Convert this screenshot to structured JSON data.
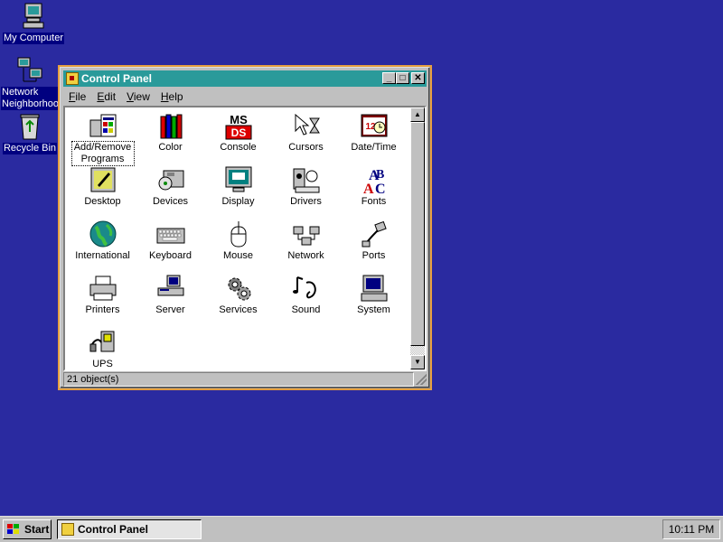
{
  "desktop": {
    "icons": [
      {
        "label": "My Computer",
        "icon": "computer-icon"
      },
      {
        "label": "Network Neighborhood",
        "icon": "network-icon"
      },
      {
        "label": "Recycle Bin",
        "icon": "recycle-bin-icon"
      }
    ]
  },
  "window": {
    "title": "Control Panel",
    "menu": [
      {
        "label": "File",
        "accel": "F",
        "rest": "ile"
      },
      {
        "label": "Edit",
        "accel": "E",
        "rest": "dit"
      },
      {
        "label": "View",
        "accel": "V",
        "rest": "iew"
      },
      {
        "label": "Help",
        "accel": "H",
        "rest": "elp"
      }
    ],
    "buttons": {
      "minimize": "_",
      "maximize": "□",
      "close": "✕"
    },
    "items": [
      {
        "label": "Add/Remove Programs",
        "icon": "add-remove-programs-icon",
        "selected": true
      },
      {
        "label": "Color",
        "icon": "color-icon"
      },
      {
        "label": "Console",
        "icon": "console-icon"
      },
      {
        "label": "Cursors",
        "icon": "cursors-icon"
      },
      {
        "label": "Date/Time",
        "icon": "date-time-icon"
      },
      {
        "label": "Desktop",
        "icon": "desktop-icon"
      },
      {
        "label": "Devices",
        "icon": "devices-icon"
      },
      {
        "label": "Display",
        "icon": "display-icon"
      },
      {
        "label": "Drivers",
        "icon": "drivers-icon"
      },
      {
        "label": "Fonts",
        "icon": "fonts-icon"
      },
      {
        "label": "International",
        "icon": "international-icon"
      },
      {
        "label": "Keyboard",
        "icon": "keyboard-icon"
      },
      {
        "label": "Mouse",
        "icon": "mouse-icon"
      },
      {
        "label": "Network",
        "icon": "network-icon"
      },
      {
        "label": "Ports",
        "icon": "ports-icon"
      },
      {
        "label": "Printers",
        "icon": "printers-icon"
      },
      {
        "label": "Server",
        "icon": "server-icon"
      },
      {
        "label": "Services",
        "icon": "services-icon"
      },
      {
        "label": "Sound",
        "icon": "sound-icon"
      },
      {
        "label": "System",
        "icon": "system-icon"
      },
      {
        "label": "UPS",
        "icon": "ups-icon"
      }
    ],
    "status": "21 object(s)"
  },
  "taskbar": {
    "start_label": "Start",
    "task_label": "Control Panel",
    "clock": "10:11 PM"
  },
  "colors": {
    "desktop": "#2a2aa0",
    "titlebar": "#2a9a9a",
    "selection": "#000080"
  }
}
